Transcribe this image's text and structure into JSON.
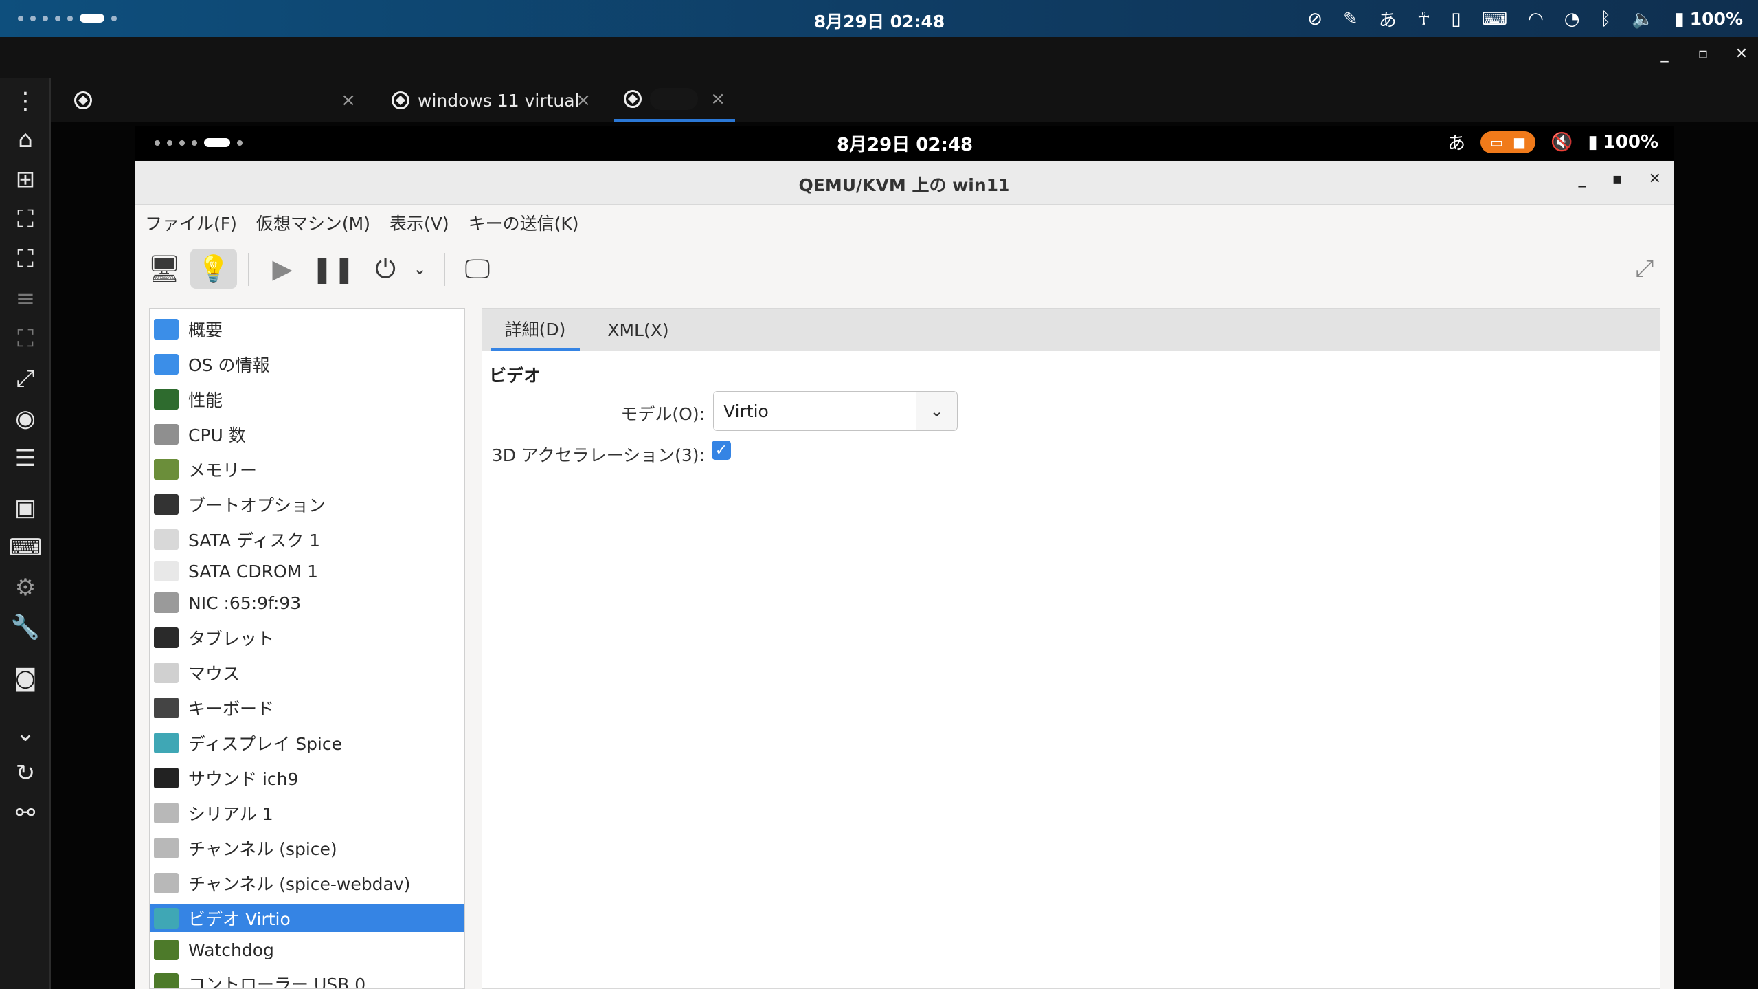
{
  "host_status": {
    "clock": "8月29日 02:48",
    "battery": "100%",
    "icons": [
      "sync-off-icon",
      "pen-icon",
      "ime-icon",
      "accessibility-icon",
      "battery-small-icon",
      "keyboard-icon",
      "headset-icon",
      "wifi-icon",
      "bluetooth-icon",
      "volume-icon",
      "battery-icon"
    ],
    "ime_label": "あ"
  },
  "chrome": {
    "minimize": "_",
    "maximize": "▫",
    "close": "✕"
  },
  "rail": {
    "items": [
      "more-icon",
      "home-icon",
      "add-icon",
      "fit-icon",
      "fullscreen-icon",
      "menu-icon",
      "resize-icon",
      "scale-icon",
      "eye-icon",
      "list-icon",
      "window-icon",
      "keyboard-icon",
      "settings-icon",
      "wrench-icon",
      "camera-icon",
      "chevron-down-icon",
      "refresh-icon",
      "disconnect-icon"
    ]
  },
  "tabs": [
    {
      "label": "",
      "close": "×"
    },
    {
      "label": "windows 11 virtual",
      "close": "×"
    },
    {
      "label": "",
      "close": "×"
    }
  ],
  "guest_status": {
    "clock": "8月29日 02:48",
    "ime_label": "あ",
    "battery": "100%",
    "accent": "#f07a1a"
  },
  "window": {
    "title": "QEMU/KVM 上の win11",
    "controls": {
      "minimize": "_",
      "maximize": "▪",
      "close": "✕"
    },
    "menu": [
      "ファイル(F)",
      "仮想マシン(M)",
      "表示(V)",
      "キーの送信(K)"
    ]
  },
  "toolbar": {
    "items": [
      "console-icon",
      "info-icon",
      "play-icon",
      "pause-icon",
      "power-icon",
      "dropdown-icon",
      "screenshot-icon",
      "fullscreen-icon"
    ]
  },
  "devices": [
    {
      "label": "概要",
      "color": "#3b8ee8"
    },
    {
      "label": "OS の情報",
      "color": "#3b8ee8"
    },
    {
      "label": "性能",
      "color": "#2e6b2e"
    },
    {
      "label": "CPU 数",
      "color": "#8f8f8f"
    },
    {
      "label": "メモリー",
      "color": "#6b8e3a"
    },
    {
      "label": "ブートオプション",
      "color": "#333333"
    },
    {
      "label": "SATA ディスク 1",
      "color": "#d8d8d8"
    },
    {
      "label": "SATA CDROM 1",
      "color": "#e8e8e8"
    },
    {
      "label": "NIC :65:9f:93",
      "color": "#9a9a9a"
    },
    {
      "label": "タブレット",
      "color": "#2a2a2a"
    },
    {
      "label": "マウス",
      "color": "#d0d0d0"
    },
    {
      "label": "キーボード",
      "color": "#444444"
    },
    {
      "label": "ディスプレイ Spice",
      "color": "#3fa7b5"
    },
    {
      "label": "サウンド ich9",
      "color": "#222222"
    },
    {
      "label": "シリアル 1",
      "color": "#b8b8b8"
    },
    {
      "label": "チャンネル (spice)",
      "color": "#b8b8b8"
    },
    {
      "label": "チャンネル (spice-webdav)",
      "color": "#b8b8b8"
    },
    {
      "label": "ビデオ Virtio",
      "color": "#3fa7b5",
      "selected": true
    },
    {
      "label": "Watchdog",
      "color": "#4d7a2a"
    },
    {
      "label": "コントローラー USB 0",
      "color": "#4d7a2a"
    }
  ],
  "details": {
    "tabs": [
      "詳細(D)",
      "XML(X)"
    ],
    "section": "ビデオ",
    "model_label": "モデル(O):",
    "model_value": "Virtio",
    "accel_label": "3D アクセラレーション(3):",
    "accel_checked": true
  }
}
